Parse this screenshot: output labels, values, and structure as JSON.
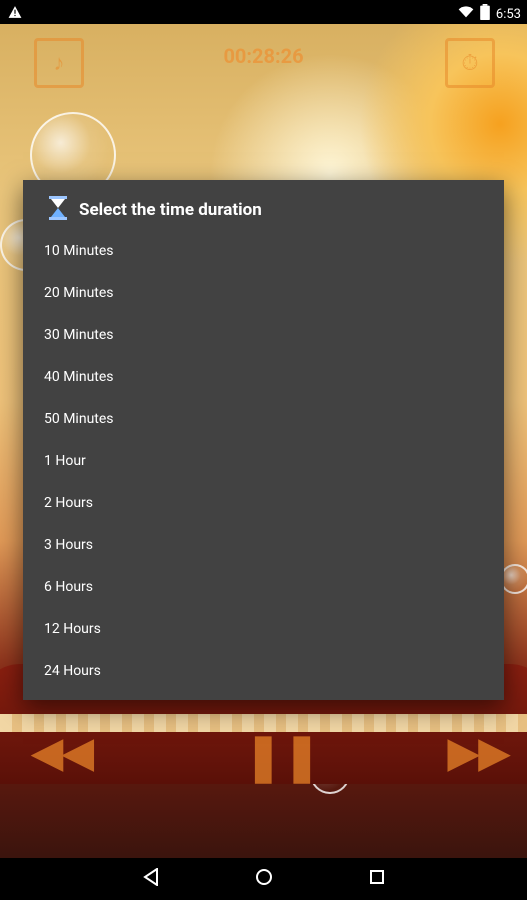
{
  "status_bar": {
    "time": "6:53"
  },
  "app": {
    "timer_text": "00:28:26"
  },
  "dialog": {
    "title": "Select the time duration",
    "options": [
      "10 Minutes",
      "20 Minutes",
      "30 Minutes",
      "40 Minutes",
      "50 Minutes",
      "1 Hour",
      "2 Hours",
      "3 Hours",
      "6 Hours",
      "12 Hours",
      "24 Hours"
    ]
  },
  "icons": {
    "dialog_icon": "hourglass-icon",
    "warning": "warning-icon",
    "wifi": "wifi-icon",
    "battery": "battery-icon",
    "back": "back-icon",
    "home": "home-icon",
    "recents": "recents-icon"
  },
  "colors": {
    "dialog_bg": "#424242",
    "accent": "#f08a2a"
  }
}
